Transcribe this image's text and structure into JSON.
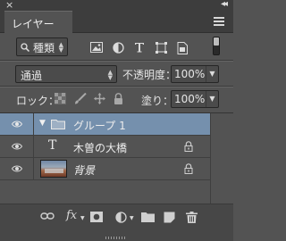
{
  "window": {
    "close_glyph": "×",
    "collapse_glyph": "◂◂"
  },
  "tabs": [
    {
      "label": "レイヤー"
    }
  ],
  "filter": {
    "kind_label": "種類",
    "icons": [
      "pixel-filter-icon",
      "adjustment-filter-icon",
      "type-filter-icon",
      "shape-filter-icon",
      "smart-object-filter-icon"
    ]
  },
  "blend": {
    "mode": "通過",
    "opacity_label": "不透明度：",
    "opacity_value": "100%"
  },
  "lock": {
    "label": "ロック：",
    "fill_label": "塗り：",
    "fill_value": "100%"
  },
  "layers": [
    {
      "name": "グループ 1",
      "type": "group",
      "selected": true
    },
    {
      "name": "木曽の大橋",
      "type": "text",
      "locked": true
    },
    {
      "name": "背景",
      "type": "image",
      "locked": true
    }
  ],
  "footer": {
    "fx_label": "fx",
    "icons": [
      "link-layers-icon",
      "fx-icon",
      "add-mask-icon",
      "adjustment-layer-icon",
      "new-group-icon",
      "new-layer-icon",
      "delete-layer-icon"
    ]
  },
  "colors": {
    "panel_bg": "#535353",
    "selected_row": "#7590ad"
  }
}
